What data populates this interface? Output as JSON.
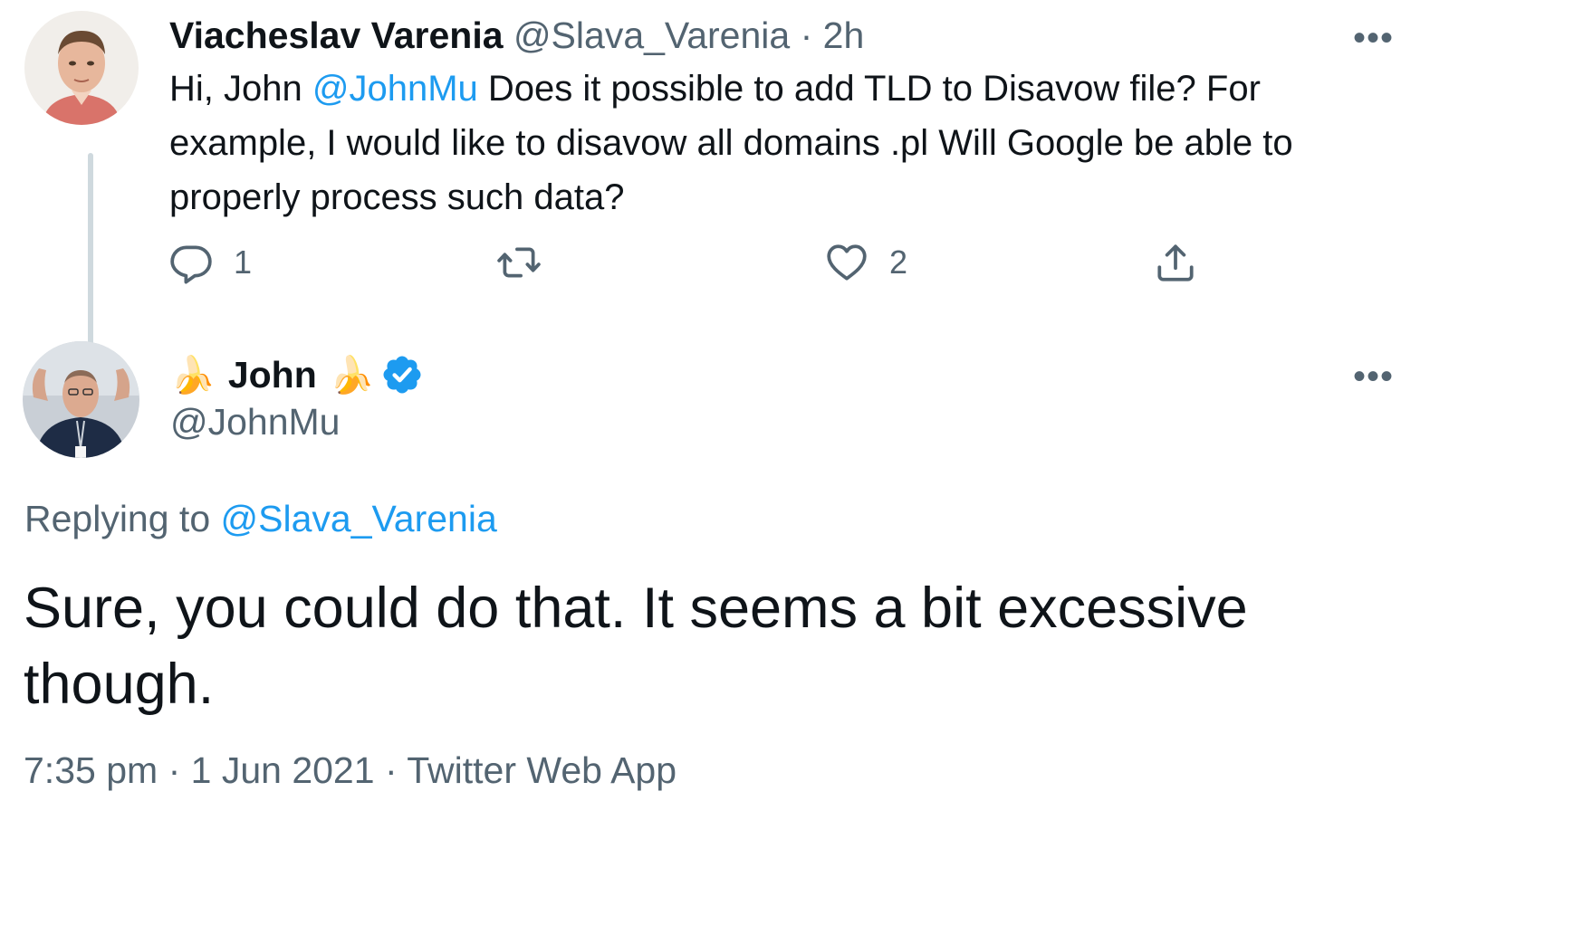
{
  "parent_tweet": {
    "author_name": "Viacheslav Varenia",
    "handle": "@Slava_Varenia",
    "separator": "·",
    "time": "2h",
    "text_prefix": "Hi, John ",
    "mention": "@JohnMu",
    "text_suffix": " Does it possible to add TLD to Disavow file? For example, I would like to disavow all domains .pl Will Google be able to properly process such data?",
    "actions": {
      "reply_count": "1",
      "retweet_count": "",
      "like_count": "2"
    }
  },
  "main_tweet": {
    "author_name": "John",
    "name_emoji": "🍌",
    "handle": "@JohnMu",
    "verified": true,
    "replying_label": "Replying to ",
    "replying_to": "@Slava_Varenia",
    "text": "Sure, you could do that. It seems a bit excessive though.",
    "time": "7:35 pm",
    "separator": "·",
    "date": "1 Jun 2021",
    "source": "Twitter Web App"
  },
  "more_label": "•••",
  "colors": {
    "link": "#1d9bf0",
    "muted": "#536471",
    "text": "#0f1419",
    "thread_line": "#cfd9de"
  },
  "icons": [
    "reply-icon",
    "retweet-icon",
    "like-icon",
    "share-icon",
    "verified-badge-icon",
    "more-icon"
  ]
}
